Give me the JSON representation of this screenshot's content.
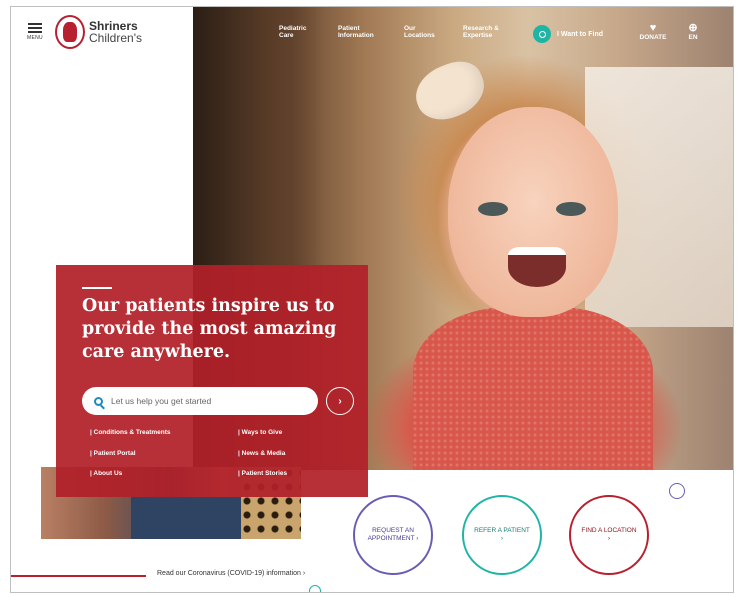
{
  "header": {
    "menu_label": "MENU",
    "logo_line1": "Shriners",
    "logo_line2": "Children's",
    "nav": [
      {
        "label": "Pediatric Care"
      },
      {
        "label": "Patient Information"
      },
      {
        "label": "Our Locations"
      },
      {
        "label": "Research & Expertise"
      }
    ],
    "find_label": "I Want to Find",
    "donate_label": "DONATE",
    "lang_label": "EN"
  },
  "promo": {
    "title": "Our patients inspire us to provide the most amazing care anywhere.",
    "search_placeholder": "Let us help you get started",
    "go_label": "›",
    "links": [
      {
        "label": "| Conditions & Treatments"
      },
      {
        "label": "| Ways to Give"
      },
      {
        "label": "| Patient Portal"
      },
      {
        "label": "| News & Media"
      },
      {
        "label": "| About Us"
      },
      {
        "label": "| Patient Stories"
      }
    ]
  },
  "cta": [
    {
      "label": "REQUEST AN APPOINTMENT ›"
    },
    {
      "label": "REFER A PATIENT ›"
    },
    {
      "label": "FIND A LOCATION ›"
    }
  ],
  "covid_notice": "Read our Coronavirus (COVID-19) information ›",
  "colors": {
    "brand_red": "#b7202e",
    "teal": "#1fb5a4",
    "purple": "#6a5bb5"
  },
  "icons": [
    "hamburger-icon",
    "search-icon",
    "donate-hand-icon",
    "globe-icon",
    "arrow-right-icon"
  ]
}
